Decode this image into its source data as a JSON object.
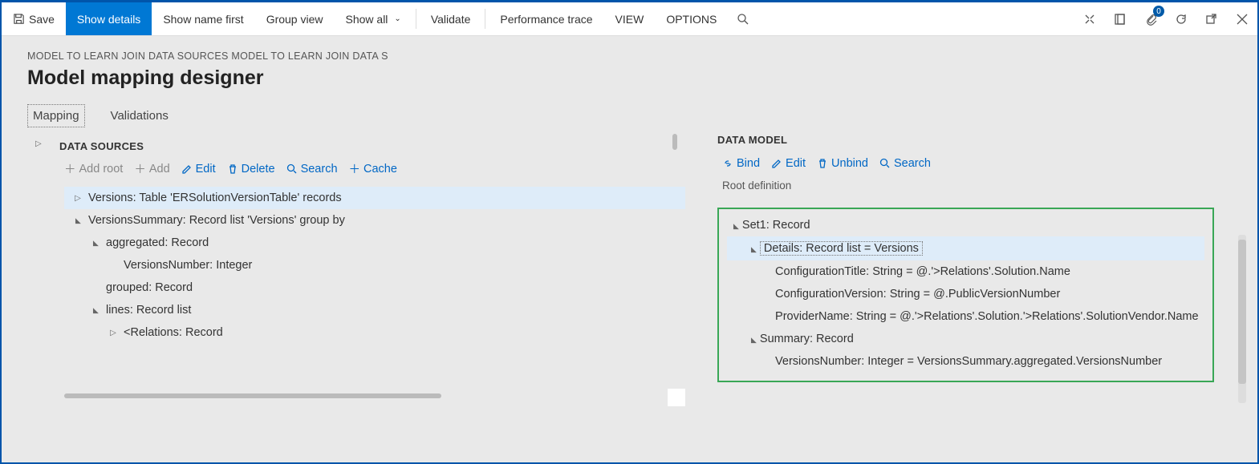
{
  "toolbar": {
    "save": "Save",
    "show_details": "Show details",
    "show_name_first": "Show name first",
    "group_view": "Group view",
    "show_all": "Show all",
    "validate": "Validate",
    "perf_trace": "Performance trace",
    "view": "VIEW",
    "options": "OPTIONS",
    "attach_count": "0"
  },
  "breadcrumb": "MODEL TO LEARN JOIN DATA SOURCES MODEL TO LEARN JOIN DATA S",
  "title": "Model mapping designer",
  "tabs": {
    "mapping": "Mapping",
    "validations": "Validations"
  },
  "datasources": {
    "header": "DATA SOURCES",
    "actions": {
      "add_root": "Add root",
      "add": "Add",
      "edit": "Edit",
      "delete": "Delete",
      "search": "Search",
      "cache": "Cache"
    },
    "tree": [
      {
        "depth": 0,
        "caret": "right",
        "text": "Versions: Table 'ERSolutionVersionTable' records",
        "selected": true
      },
      {
        "depth": 0,
        "caret": "down",
        "text": "VersionsSummary: Record list 'Versions' group by"
      },
      {
        "depth": 1,
        "caret": "down",
        "text": "aggregated: Record"
      },
      {
        "depth": 2,
        "caret": "",
        "text": "VersionsNumber: Integer"
      },
      {
        "depth": 1,
        "caret": "",
        "text": "grouped: Record"
      },
      {
        "depth": 1,
        "caret": "down",
        "text": "lines: Record list"
      },
      {
        "depth": 2,
        "caret": "right",
        "text": "<Relations: Record"
      }
    ]
  },
  "datamodel": {
    "header": "DATA MODEL",
    "actions": {
      "bind": "Bind",
      "edit": "Edit",
      "unbind": "Unbind",
      "search": "Search"
    },
    "root_label": "Root definition",
    "tree": [
      {
        "depth": 0,
        "caret": "down",
        "text": "Set1: Record"
      },
      {
        "depth": 1,
        "caret": "down",
        "text": "Details: Record list = Versions",
        "selected": true
      },
      {
        "depth": 2,
        "caret": "",
        "text": "ConfigurationTitle: String = @.'>Relations'.Solution.Name"
      },
      {
        "depth": 2,
        "caret": "",
        "text": "ConfigurationVersion: String = @.PublicVersionNumber"
      },
      {
        "depth": 2,
        "caret": "",
        "text": "ProviderName: String = @.'>Relations'.Solution.'>Relations'.SolutionVendor.Name"
      },
      {
        "depth": 1,
        "caret": "down",
        "text": "Summary: Record"
      },
      {
        "depth": 2,
        "caret": "",
        "text": "VersionsNumber: Integer = VersionsSummary.aggregated.VersionsNumber"
      }
    ]
  }
}
